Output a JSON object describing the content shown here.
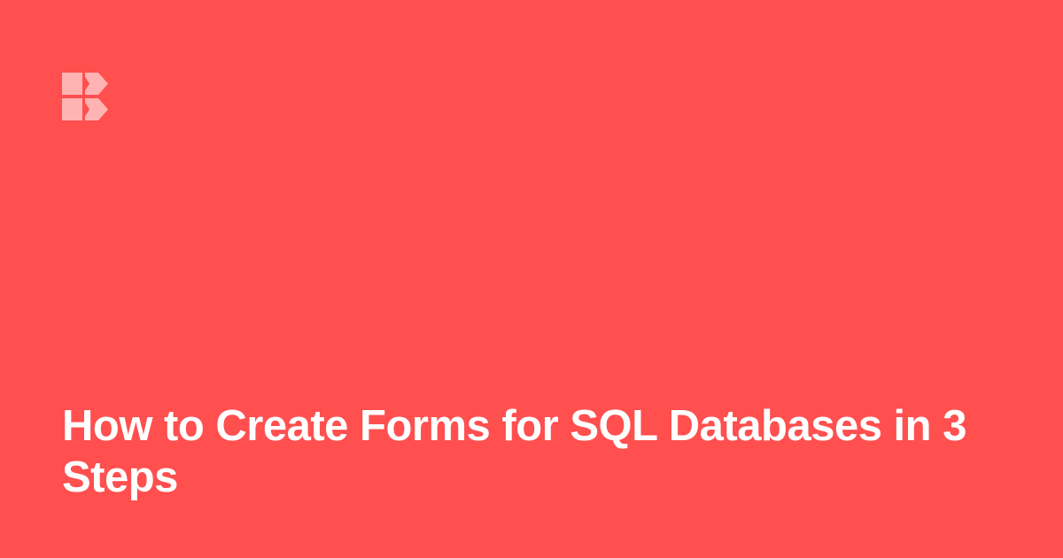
{
  "brand": {
    "logo_icon": "budibase-logo-icon",
    "logo_color": "#FFB3B3"
  },
  "article": {
    "title": "How to Create Forms for SQL Databases in 3 Steps"
  },
  "theme": {
    "background": "#FF4F4F",
    "text": "#FFFFFF"
  }
}
